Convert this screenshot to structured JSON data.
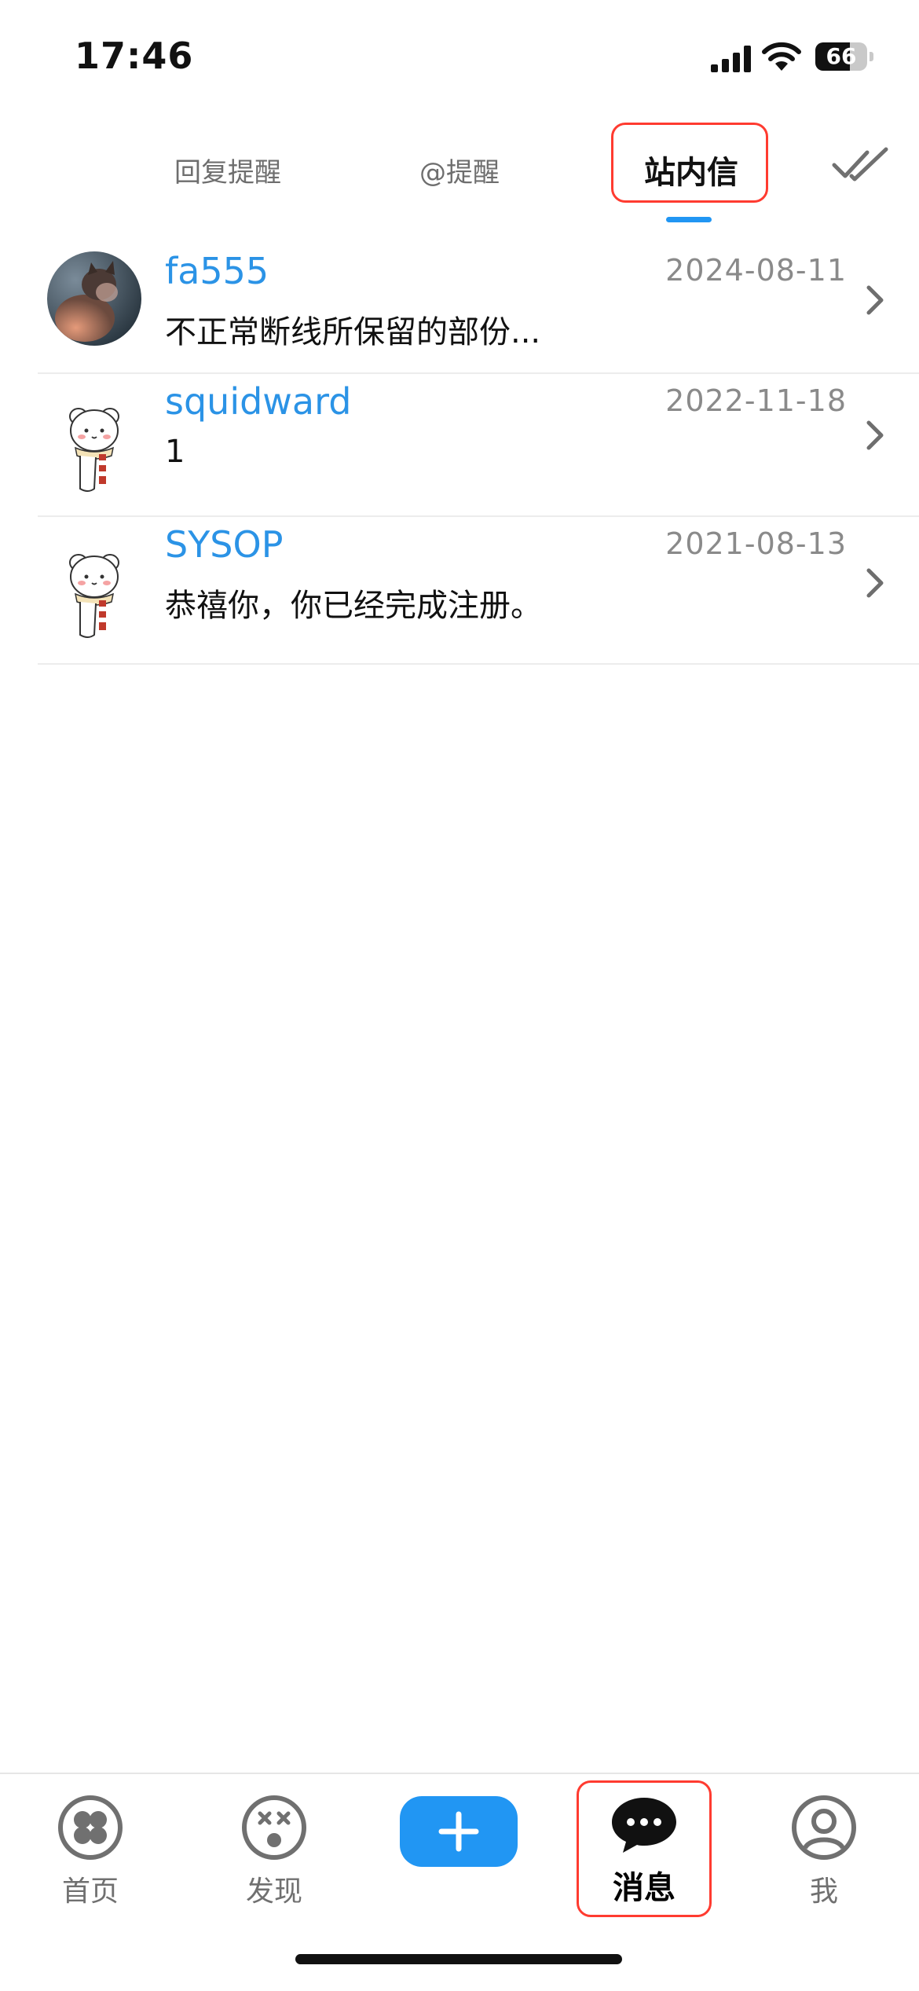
{
  "status_bar": {
    "time": "17:46",
    "battery": "66",
    "battery_level": 0.66
  },
  "tabs": {
    "reply": "回复提醒",
    "at": "@提醒",
    "pm": "站内信",
    "active": "pm"
  },
  "icons": {
    "mark_all_read": "double-check-icon",
    "row_chevron": "chevron-right-icon",
    "nav_home": "clover-icon",
    "nav_discover": "dizzy-face-icon",
    "nav_compose": "plus-icon",
    "nav_messages": "chat-bubble-icon",
    "nav_me": "user-circle-icon"
  },
  "messages": [
    {
      "name": "fa555",
      "date": "2024-08-11",
      "preview": "不正常断线所保留的部份...",
      "avatar": "cat-photo-avatar"
    },
    {
      "name": "squidward",
      "date": "2022-11-18",
      "preview": "1",
      "avatar": "bear-avatar"
    },
    {
      "name": "SYSOP",
      "date": "2021-08-13",
      "preview": "恭禧你，你已经完成注册。",
      "avatar": "bear-avatar"
    }
  ],
  "bottom_nav": {
    "home": "首页",
    "discover": "发现",
    "messages": "消息",
    "me": "我",
    "active": "messages"
  },
  "colors": {
    "accent": "#2196f3",
    "name_blue": "#2b93e6",
    "highlight_red": "#ff3b30",
    "muted": "#8a8a8a"
  }
}
